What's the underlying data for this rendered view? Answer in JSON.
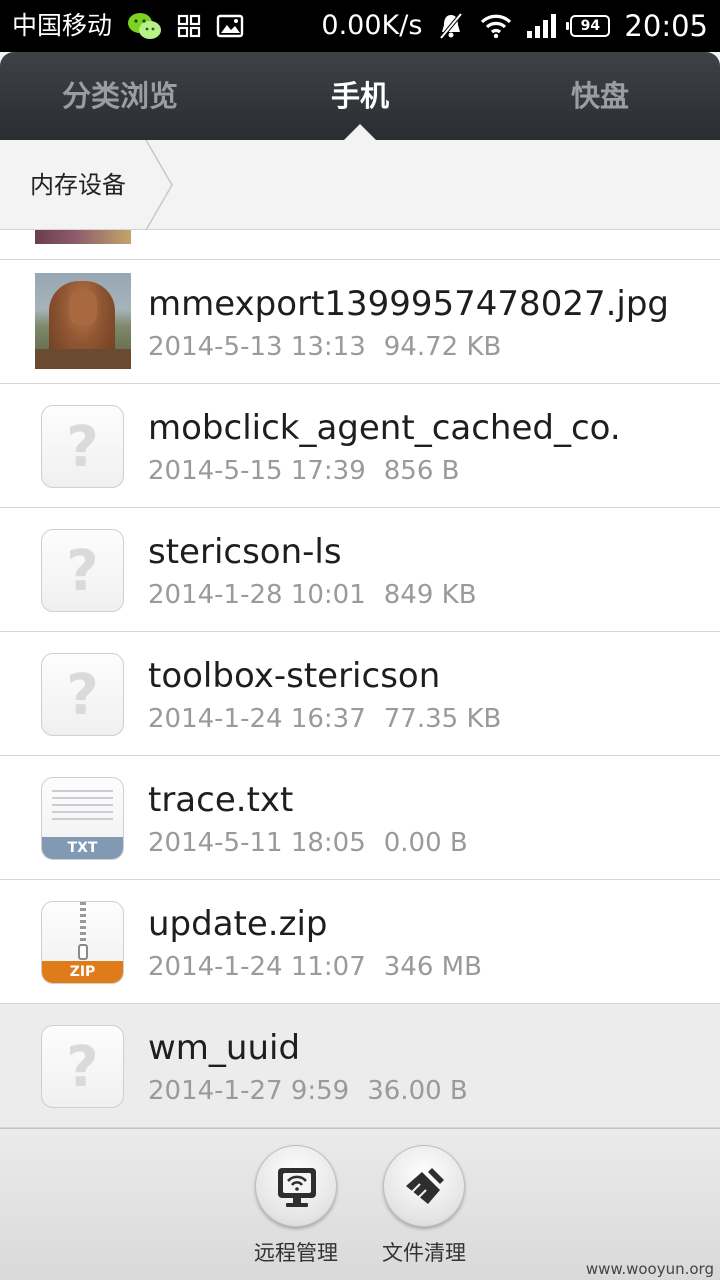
{
  "status_bar": {
    "carrier": "中国移动",
    "net_speed": "0.00K/s",
    "battery": "94",
    "time": "20:05"
  },
  "tabs": [
    {
      "label": "分类浏览",
      "active": false
    },
    {
      "label": "手机",
      "active": true
    },
    {
      "label": "快盘",
      "active": false
    }
  ],
  "breadcrumb": {
    "current": "内存设备"
  },
  "files": [
    {
      "name": "mmexport1399957478027.jpg",
      "date": "2014-5-13 13:13",
      "size": "94.72 KB",
      "icon": "photo-thumbnail"
    },
    {
      "name": "mobclick_agent_cached_co.",
      "date": "2014-5-15 17:39",
      "size": "856 B",
      "icon": "unknown-file-icon"
    },
    {
      "name": "stericson-ls",
      "date": "2014-1-28 10:01",
      "size": "849 KB",
      "icon": "unknown-file-icon"
    },
    {
      "name": "toolbox-stericson",
      "date": "2014-1-24 16:37",
      "size": "77.35 KB",
      "icon": "unknown-file-icon"
    },
    {
      "name": "trace.txt",
      "date": "2014-5-11 18:05",
      "size": "0.00 B",
      "icon": "txt-file-icon",
      "tag": "TXT"
    },
    {
      "name": "update.zip",
      "date": "2014-1-24 11:07",
      "size": "346 MB",
      "icon": "zip-file-icon",
      "tag": "ZIP"
    },
    {
      "name": "wm_uuid",
      "date": "2014-1-27 9:59",
      "size": "36.00 B",
      "icon": "unknown-file-icon",
      "pressed": true
    }
  ],
  "bottom_actions": [
    {
      "label": "远程管理",
      "icon": "remote-monitor-icon"
    },
    {
      "label": "文件清理",
      "icon": "broom-clean-icon"
    }
  ],
  "watermark": "www.wooyun.org"
}
